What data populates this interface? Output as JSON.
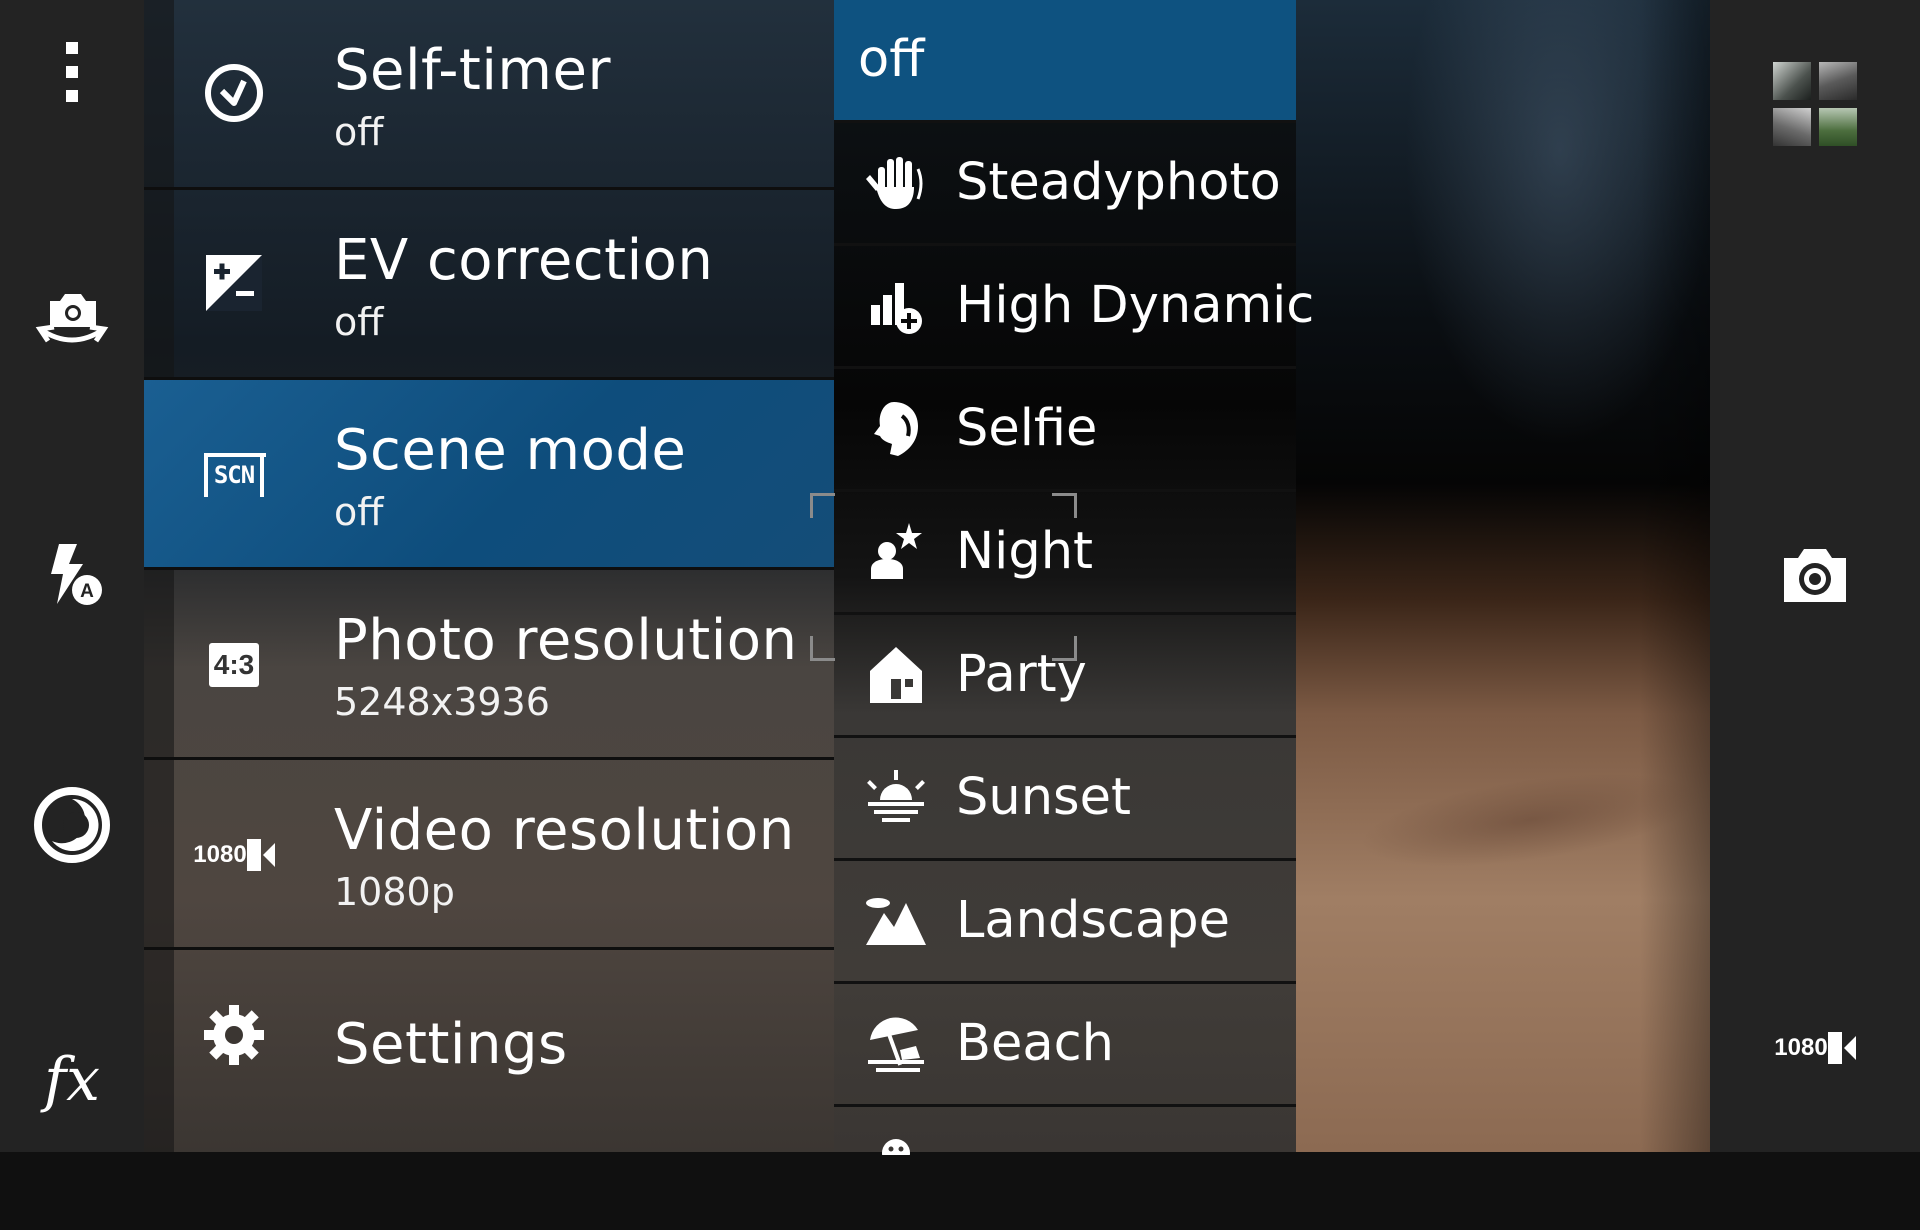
{
  "left_rail": {
    "items": [
      {
        "name": "overflow-menu-icon"
      },
      {
        "name": "switch-camera-icon"
      },
      {
        "name": "flash-auto-icon"
      },
      {
        "name": "capture-mode-icon"
      },
      {
        "name": "effects-icon",
        "glyph": "fx"
      }
    ]
  },
  "settings_menu": {
    "items": [
      {
        "icon": "timer-icon",
        "label": "Self-timer",
        "value": "off"
      },
      {
        "icon": "ev-icon",
        "label": "EV correction",
        "value": "off"
      },
      {
        "icon": "scene-icon",
        "label": "Scene mode",
        "value": "off",
        "selected": true,
        "icon_text": "SCN"
      },
      {
        "icon": "aspect-ratio-icon",
        "label": "Photo resolution",
        "value": "5248x3936",
        "icon_text": "4:3"
      },
      {
        "icon": "video-resolution-icon",
        "label": "Video resolution",
        "value": "1080p",
        "icon_text": "1080"
      },
      {
        "icon": "gear-icon",
        "label": "Settings"
      }
    ]
  },
  "scene_list": {
    "items": [
      {
        "label": "off",
        "active": true
      },
      {
        "label": "Steadyphoto",
        "icon": "hand-icon"
      },
      {
        "label": "High Dynamic",
        "icon": "hdr-icon"
      },
      {
        "label": "Selfie",
        "icon": "selfie-icon"
      },
      {
        "label": "Night",
        "icon": "night-icon"
      },
      {
        "label": "Party",
        "icon": "party-icon"
      },
      {
        "label": "Sunset",
        "icon": "sunset-icon"
      },
      {
        "label": "Landscape",
        "icon": "landscape-icon"
      },
      {
        "label": "Beach",
        "icon": "beach-icon"
      }
    ]
  },
  "right_rail": {
    "gallery": "gallery-thumbnails",
    "shutter": "camera-shutter-icon",
    "record": {
      "name": "record-video-icon",
      "text": "1080"
    }
  },
  "colors": {
    "accent_blue": "#0e5280",
    "rail": "#232323"
  }
}
